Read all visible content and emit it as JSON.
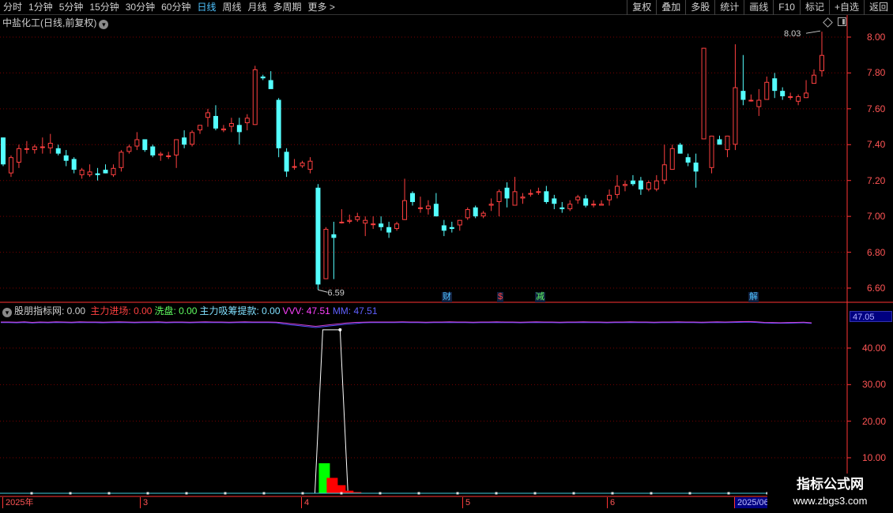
{
  "toolbar": {
    "periods": [
      {
        "label": "分时",
        "active": false
      },
      {
        "label": "1分钟",
        "active": false
      },
      {
        "label": "5分钟",
        "active": false
      },
      {
        "label": "15分钟",
        "active": false
      },
      {
        "label": "30分钟",
        "active": false
      },
      {
        "label": "60分钟",
        "active": false
      },
      {
        "label": "日线",
        "active": true
      },
      {
        "label": "周线",
        "active": false
      },
      {
        "label": "月线",
        "active": false
      },
      {
        "label": "多周期",
        "active": false
      },
      {
        "label": "更多 >",
        "active": false
      }
    ],
    "buttons": [
      "复权",
      "叠加",
      "多股",
      "统计",
      "画线",
      "F10",
      "标记",
      "+自选",
      "返回"
    ]
  },
  "main_chart": {
    "title": "中盐化工(日线,前复权)",
    "price_axis": [
      "8.00",
      "7.80",
      "7.60",
      "7.40",
      "7.20",
      "7.00",
      "6.80",
      "6.60"
    ],
    "high_marker": "8.03",
    "low_marker": "6.59",
    "event_tags": [
      {
        "text": "财",
        "color": "#4fc3ff"
      },
      {
        "text": "$",
        "color": "#ff4040"
      },
      {
        "text": "减",
        "color": "#60ff60"
      },
      {
        "text": "解",
        "color": "#4fc3ff"
      }
    ]
  },
  "indicator": {
    "name": "股朋指标网",
    "name_value": ": 0.00",
    "items": [
      {
        "label": "主力进场:",
        "value": "0.00",
        "color": "#ff4040"
      },
      {
        "label": "洗盘:",
        "value": "0.00",
        "color": "#60ff60"
      },
      {
        "label": "主力吸筹提款:",
        "value": "0.00",
        "color": "#80e0ff"
      },
      {
        "label": "VVV:",
        "value": "47.51",
        "color": "#ff40ff"
      },
      {
        "label": "MM:",
        "value": "47.51",
        "color": "#6060ff"
      }
    ],
    "axis": [
      "40.00",
      "30.00",
      "20.00",
      "10.00"
    ],
    "current_value": "47.05"
  },
  "dates": [
    "2025年",
    "3",
    "4",
    "5",
    "6",
    "2025/06"
  ],
  "watermark": {
    "line1": "指标公式网",
    "line2": "www.zbgs3.com"
  },
  "colors": {
    "up": "#ff4040",
    "down": "#54ffff",
    "grid": "#7a0000",
    "axis": "#ff3333"
  },
  "chart_data": {
    "type": "candlestick",
    "candles": [
      [
        7.44,
        7.44,
        7.28,
        7.29
      ],
      [
        7.24,
        7.34,
        7.22,
        7.33
      ],
      [
        7.3,
        7.4,
        7.27,
        7.38
      ],
      [
        7.38,
        7.42,
        7.35,
        7.38
      ],
      [
        7.37,
        7.4,
        7.35,
        7.39
      ],
      [
        7.39,
        7.44,
        7.35,
        7.39
      ],
      [
        7.38,
        7.46,
        7.35,
        7.41
      ],
      [
        7.38,
        7.4,
        7.34,
        7.35
      ],
      [
        7.34,
        7.37,
        7.28,
        7.31
      ],
      [
        7.32,
        7.33,
        7.24,
        7.26
      ],
      [
        7.23,
        7.27,
        7.21,
        7.26
      ],
      [
        7.23,
        7.29,
        7.22,
        7.25
      ],
      [
        7.24,
        7.27,
        7.2,
        7.23
      ],
      [
        7.26,
        7.29,
        7.24,
        7.24
      ],
      [
        7.23,
        7.29,
        7.22,
        7.27
      ],
      [
        7.27,
        7.37,
        7.25,
        7.36
      ],
      [
        7.36,
        7.4,
        7.35,
        7.39
      ],
      [
        7.39,
        7.47,
        7.37,
        7.43
      ],
      [
        7.43,
        7.43,
        7.36,
        7.37
      ],
      [
        7.39,
        7.4,
        7.33,
        7.34
      ],
      [
        7.34,
        7.36,
        7.31,
        7.35
      ],
      [
        7.34,
        7.36,
        7.32,
        7.34
      ],
      [
        7.34,
        7.43,
        7.27,
        7.43
      ],
      [
        7.44,
        7.48,
        7.38,
        7.4
      ],
      [
        7.4,
        7.48,
        7.39,
        7.47
      ],
      [
        7.48,
        7.51,
        7.46,
        7.51
      ],
      [
        7.55,
        7.6,
        7.5,
        7.58
      ],
      [
        7.56,
        7.62,
        7.48,
        7.49
      ],
      [
        7.48,
        7.51,
        7.47,
        7.49
      ],
      [
        7.5,
        7.55,
        7.47,
        7.52
      ],
      [
        7.51,
        7.55,
        7.4,
        7.47
      ],
      [
        7.52,
        7.57,
        7.48,
        7.55
      ],
      [
        7.51,
        7.84,
        7.51,
        7.82
      ],
      [
        7.78,
        7.79,
        7.76,
        7.77
      ],
      [
        7.76,
        7.81,
        7.74,
        7.71
      ],
      [
        7.65,
        7.66,
        7.33,
        7.38
      ],
      [
        7.36,
        7.38,
        7.22,
        7.25
      ],
      [
        7.28,
        7.32,
        7.26,
        7.28
      ],
      [
        7.28,
        7.31,
        7.27,
        7.3
      ],
      [
        7.26,
        7.33,
        7.24,
        7.31
      ],
      [
        7.16,
        7.18,
        6.59,
        6.62
      ],
      [
        6.65,
        6.94,
        6.65,
        6.93
      ],
      [
        6.9,
        6.97,
        6.65,
        6.88
      ],
      [
        6.97,
        7.04,
        6.96,
        6.97
      ],
      [
        6.97,
        7.01,
        6.96,
        6.98
      ],
      [
        6.98,
        7.02,
        6.97,
        7.0
      ],
      [
        6.96,
        7.0,
        6.89,
        6.98
      ],
      [
        6.96,
        7.0,
        6.93,
        6.96
      ],
      [
        6.96,
        7.0,
        6.92,
        6.94
      ],
      [
        6.94,
        6.97,
        6.88,
        6.91
      ],
      [
        6.93,
        6.97,
        6.92,
        6.96
      ],
      [
        6.98,
        7.21,
        6.98,
        7.09
      ],
      [
        7.13,
        7.14,
        7.06,
        7.08
      ],
      [
        7.05,
        7.11,
        7.02,
        7.05
      ],
      [
        7.04,
        7.09,
        7.01,
        7.06
      ],
      [
        7.07,
        7.13,
        7.0,
        7.0
      ],
      [
        6.95,
        6.98,
        6.89,
        6.92
      ],
      [
        6.94,
        6.97,
        6.91,
        6.93
      ],
      [
        6.95,
        6.98,
        6.92,
        6.98
      ],
      [
        6.99,
        7.05,
        6.98,
        7.04
      ],
      [
        7.05,
        7.06,
        6.99,
        7.0
      ],
      [
        7.0,
        7.03,
        6.99,
        7.02
      ],
      [
        7.06,
        7.1,
        7.03,
        7.07
      ],
      [
        7.08,
        7.15,
        7.0,
        7.14
      ],
      [
        7.16,
        7.19,
        7.05,
        7.1
      ],
      [
        7.06,
        7.22,
        7.06,
        7.14
      ],
      [
        7.1,
        7.13,
        7.07,
        7.11
      ],
      [
        7.13,
        7.15,
        7.11,
        7.13
      ],
      [
        7.14,
        7.16,
        7.12,
        7.14
      ],
      [
        7.14,
        7.17,
        7.07,
        7.08
      ],
      [
        7.1,
        7.12,
        7.04,
        7.07
      ],
      [
        7.05,
        7.08,
        7.02,
        7.04
      ],
      [
        7.04,
        7.09,
        7.03,
        7.07
      ],
      [
        7.09,
        7.12,
        7.07,
        7.11
      ],
      [
        7.1,
        7.12,
        7.05,
        7.06
      ],
      [
        7.07,
        7.09,
        7.05,
        7.07
      ],
      [
        7.06,
        7.09,
        7.06,
        7.07
      ],
      [
        7.09,
        7.15,
        7.06,
        7.12
      ],
      [
        7.12,
        7.23,
        7.1,
        7.17
      ],
      [
        7.17,
        7.2,
        7.14,
        7.18
      ],
      [
        7.2,
        7.23,
        7.17,
        7.18
      ],
      [
        7.2,
        7.22,
        7.12,
        7.15
      ],
      [
        7.15,
        7.2,
        7.14,
        7.19
      ],
      [
        7.15,
        7.23,
        7.14,
        7.2
      ],
      [
        7.2,
        7.4,
        7.18,
        7.29
      ],
      [
        7.26,
        7.4,
        7.26,
        7.38
      ],
      [
        7.4,
        7.41,
        7.35,
        7.35
      ],
      [
        7.33,
        7.35,
        7.28,
        7.3
      ],
      [
        7.3,
        7.35,
        7.16,
        7.25
      ],
      [
        7.43,
        7.94,
        7.43,
        7.94
      ],
      [
        7.27,
        7.45,
        7.24,
        7.45
      ],
      [
        7.43,
        7.45,
        7.4,
        7.4
      ],
      [
        7.37,
        7.45,
        7.33,
        7.45
      ],
      [
        7.4,
        7.96,
        7.37,
        7.72
      ],
      [
        7.7,
        7.9,
        7.62,
        7.65
      ],
      [
        7.65,
        7.68,
        7.64,
        7.65
      ],
      [
        7.61,
        7.71,
        7.56,
        7.65
      ],
      [
        7.65,
        7.78,
        7.65,
        7.75
      ],
      [
        7.77,
        7.8,
        7.66,
        7.7
      ],
      [
        7.7,
        7.72,
        7.65,
        7.67
      ],
      [
        7.67,
        7.69,
        7.65,
        7.67
      ],
      [
        7.64,
        7.68,
        7.62,
        7.67
      ],
      [
        7.66,
        7.76,
        7.66,
        7.69
      ],
      [
        7.74,
        7.82,
        7.74,
        7.79
      ],
      [
        7.81,
        8.03,
        7.78,
        7.9
      ]
    ],
    "indicator_vvv": [
      47.5,
      47.5,
      47.4,
      47.6,
      47.3,
      47.5,
      47.4,
      47.6,
      47.5,
      47.4,
      47.6,
      47.5,
      47.5,
      47.4,
      47.5,
      47.6,
      47.5,
      47.4,
      47.5,
      47.5,
      47.6,
      47.4,
      47.5,
      47.5,
      47.4,
      47.5,
      47.6,
      47.5,
      47.5,
      47.4,
      47.5,
      47.6,
      47.5,
      47.5,
      47.5,
      47.4,
      47.0,
      46.5,
      46.0,
      45.5,
      45.0,
      45.5,
      46.0,
      46.5,
      47.0,
      47.3,
      47.4,
      47.5,
      47.5,
      47.5,
      47.5,
      47.6,
      47.5,
      47.5,
      47.4,
      47.5,
      47.5,
      47.6,
      47.5,
      47.5,
      47.4,
      47.5,
      47.5,
      47.6,
      47.5,
      47.5,
      47.4,
      47.5,
      47.6,
      47.5,
      47.5,
      47.4,
      47.5,
      47.5,
      47.6,
      47.5,
      47.5,
      47.4,
      47.5,
      47.5,
      47.6,
      47.5,
      47.5,
      47.4,
      47.5,
      47.5,
      47.6,
      47.5,
      47.5,
      47.4,
      47.5,
      47.6,
      47.5,
      47.6,
      47.7,
      47.8,
      47.6,
      47.3,
      47.2,
      47.1,
      47.2,
      47.3,
      47.4,
      47.05
    ],
    "indicator_white_spike": {
      "start": 40,
      "peak_from": 41,
      "peak_to": 43,
      "end": 44,
      "peak": 45.0
    },
    "indicator_green_bar": {
      "index": 41,
      "value": 8.5
    },
    "indicator_red_bars": [
      [
        42,
        4.5
      ],
      [
        43,
        2.5
      ],
      [
        44,
        1.0
      ],
      [
        45,
        0.6
      ],
      [
        46,
        0.3
      ]
    ]
  }
}
